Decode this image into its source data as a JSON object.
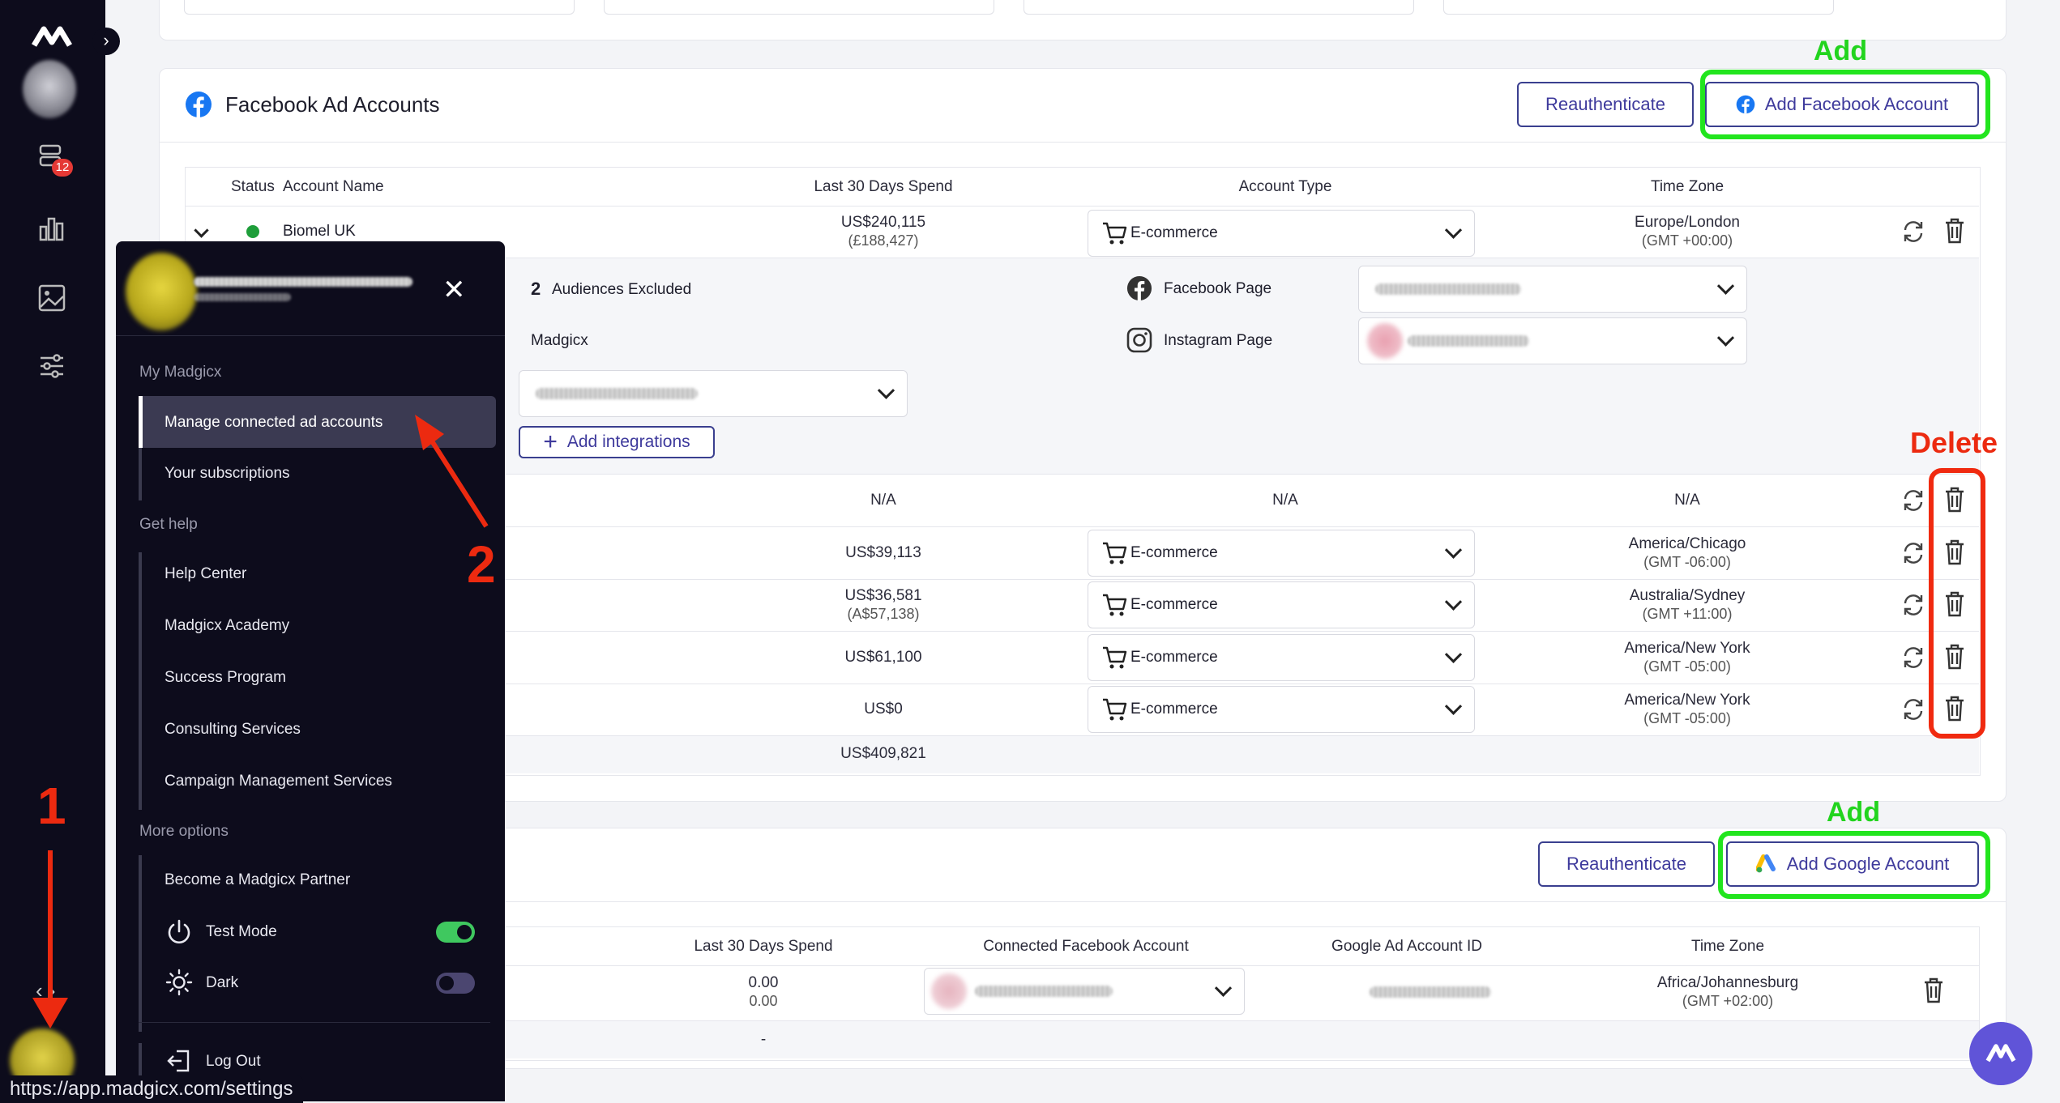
{
  "url": "https://app.madgicx.com/settings",
  "rail": {
    "badge_count": "12"
  },
  "facebook": {
    "title": "Facebook Ad Accounts",
    "reauth_label": "Reauthenticate",
    "add_label": "Add Facebook Account",
    "headers": [
      "Status",
      "Account Name",
      "Last 30 Days Spend",
      "Account Type",
      "Time Zone"
    ],
    "first_row": {
      "name": "Biomel UK",
      "spend": "US$240,115",
      "spend_local": "(£188,427)",
      "type": "E-commerce",
      "tz": "Europe/London",
      "tz_offset": "(GMT +00:00)"
    },
    "expanded": {
      "audiences_count": "2",
      "audiences_label": "Audiences Excluded",
      "madgicx_label": "Madgicx",
      "facebook_page_label": "Facebook Page",
      "instagram_page_label": "Instagram Page",
      "add_integrations_label": "Add integrations"
    },
    "na_row": {
      "name_fragment": ")",
      "spend": "N/A",
      "type": "N/A",
      "tz": "N/A"
    },
    "rows": [
      {
        "spend": "US$39,113",
        "spend_local": "",
        "type": "E-commerce",
        "tz": "America/Chicago",
        "tz_offset": "(GMT -06:00)"
      },
      {
        "spend": "US$36,581",
        "spend_local": "(A$57,138)",
        "type": "E-commerce",
        "tz": "Australia/Sydney",
        "tz_offset": "(GMT +11:00)"
      },
      {
        "spend": "US$61,100",
        "spend_local": "",
        "type": "E-commerce",
        "tz": "America/New York",
        "tz_offset": "(GMT -05:00)"
      },
      {
        "spend": "US$0",
        "spend_local": "",
        "type": "E-commerce",
        "tz": "America/New York",
        "tz_offset": "(GMT -05:00)"
      }
    ],
    "total": "US$409,821"
  },
  "google": {
    "reauth_label": "Reauthenticate",
    "add_label": "Add Google Account",
    "headers": [
      "Last 30 Days Spend",
      "Connected Facebook Account",
      "Google Ad Account ID",
      "Time Zone"
    ],
    "row": {
      "spend": "0.00",
      "spend_local": "0.00",
      "tz": "Africa/Johannesburg",
      "tz_offset": "(GMT +02:00)"
    },
    "total": "-"
  },
  "menu": {
    "section_my": "My Madgicx",
    "manage": "Manage connected ad accounts",
    "subscriptions": "Your subscriptions",
    "section_help": "Get help",
    "help_center": "Help Center",
    "academy": "Madgicx Academy",
    "success": "Success Program",
    "consulting": "Consulting Services",
    "campaign": "Campaign Management Services",
    "section_more": "More options",
    "partner": "Become a Madgicx Partner",
    "test_mode": "Test Mode",
    "dark": "Dark",
    "logout": "Log Out"
  },
  "annotations": {
    "add_top": "Add",
    "delete": "Delete",
    "add_bottom": "Add",
    "step1": "1",
    "step2": "2"
  },
  "colors": {
    "accent": "#3e3a9c",
    "highlight_green": "#22e51e",
    "highlight_red": "#f02a10",
    "toggle_on": "#3fc85f",
    "toggle_off": "#4b4670"
  }
}
